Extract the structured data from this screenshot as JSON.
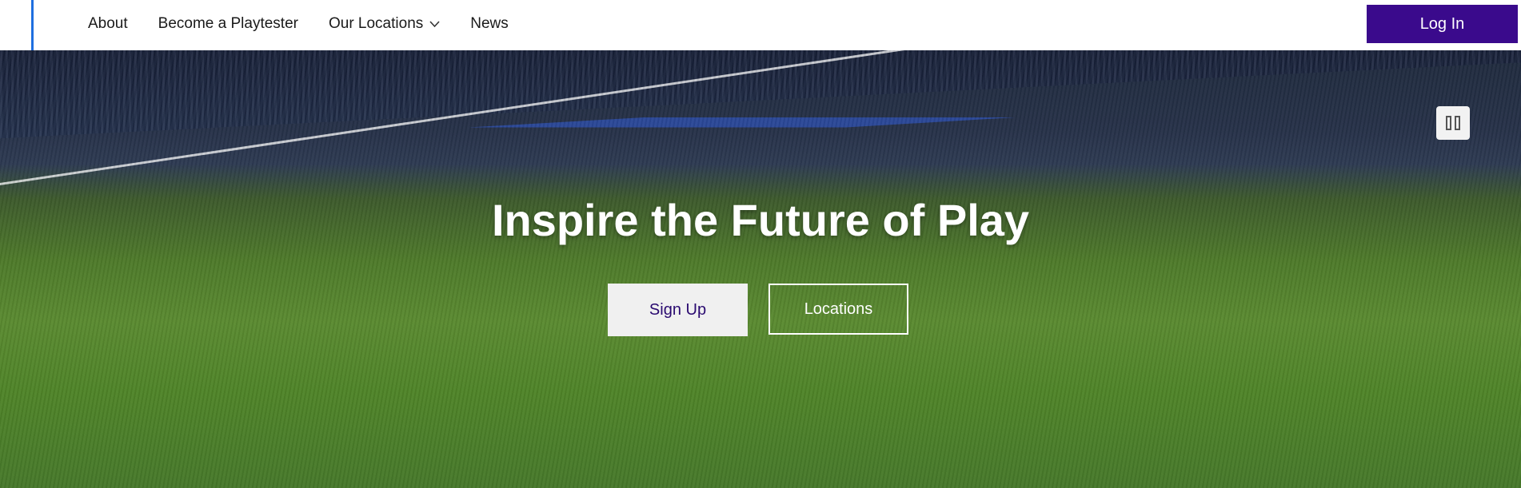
{
  "nav": {
    "items": [
      {
        "label": "About"
      },
      {
        "label": "Become a Playtester"
      },
      {
        "label": "Our Locations",
        "icon": "chevron-down-icon"
      },
      {
        "label": "News"
      }
    ],
    "login_label": "Log In"
  },
  "hero": {
    "headline": "Inspire the Future of Play",
    "signup_label": "Sign Up",
    "locations_label": "Locations",
    "media_control_icon": "pause-icon"
  },
  "colors": {
    "brand_purple": "#3a0a8c",
    "accent_blue": "#1f6fe0",
    "pitch_green": "#4e7a2a"
  }
}
